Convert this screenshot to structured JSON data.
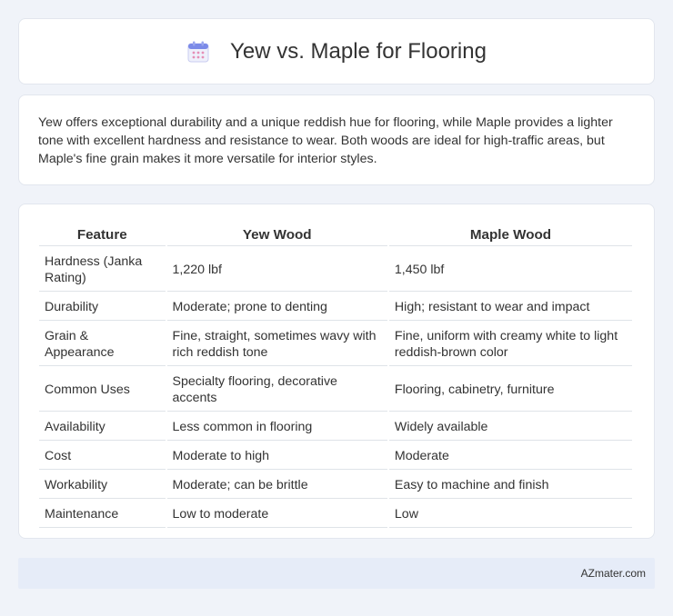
{
  "header": {
    "title": "Yew vs. Maple for Flooring",
    "icon": "calendar-icon"
  },
  "summary": {
    "text": "Yew offers exceptional durability and a unique reddish hue for flooring, while Maple provides a lighter tone with excellent hardness and resistance to wear. Both woods are ideal for high-traffic areas, but Maple's fine grain makes it more versatile for interior styles."
  },
  "table": {
    "headers": [
      "Feature",
      "Yew Wood",
      "Maple Wood"
    ],
    "rows": [
      [
        "Hardness (Janka Rating)",
        "1,220 lbf",
        "1,450 lbf"
      ],
      [
        "Durability",
        "Moderate; prone to denting",
        "High; resistant to wear and impact"
      ],
      [
        "Grain & Appearance",
        "Fine, straight, sometimes wavy with rich reddish tone",
        "Fine, uniform with creamy white to light reddish-brown color"
      ],
      [
        "Common Uses",
        "Specialty flooring, decorative accents",
        "Flooring, cabinetry, furniture"
      ],
      [
        "Availability",
        "Less common in flooring",
        "Widely available"
      ],
      [
        "Cost",
        "Moderate to high",
        "Moderate"
      ],
      [
        "Workability",
        "Moderate; can be brittle",
        "Easy to machine and finish"
      ],
      [
        "Maintenance",
        "Low to moderate",
        "Low"
      ]
    ]
  },
  "footer": {
    "text": "AZmater.com"
  }
}
